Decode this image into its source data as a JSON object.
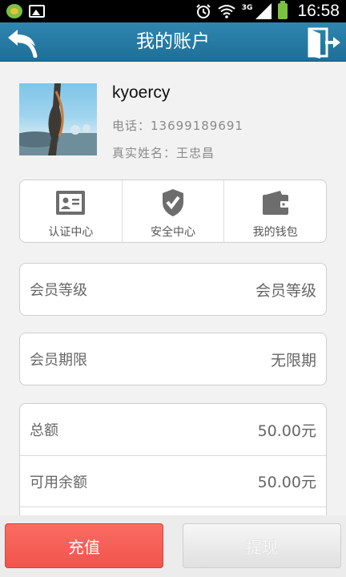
{
  "status_bar": {
    "network": "3G",
    "time": "16:58"
  },
  "header": {
    "title": "我的账户",
    "back_icon": "back-arrow-icon",
    "exit_icon": "exit-door-icon"
  },
  "profile": {
    "username": "kyoercy",
    "phone": "电话：13699189691",
    "real_name": "真实姓名：王忠昌"
  },
  "quick_actions": [
    {
      "label": "认证中心",
      "icon": "id-card-icon"
    },
    {
      "label": "安全中心",
      "icon": "shield-check-icon"
    },
    {
      "label": "我的钱包",
      "icon": "wallet-icon"
    }
  ],
  "member": {
    "level_label": "会员等级",
    "level_value": "会员等级",
    "period_label": "会员期限",
    "period_value": "无限期"
  },
  "balance": {
    "total_label": "总额",
    "total_value": "50.00元",
    "available_label": "可用余额",
    "available_value": "50.00元"
  },
  "actions": {
    "recharge": "充值",
    "withdraw": "提现"
  },
  "colors": {
    "header": "#2279a4",
    "recharge": "#f55d54",
    "background": "#f2f2f2"
  }
}
